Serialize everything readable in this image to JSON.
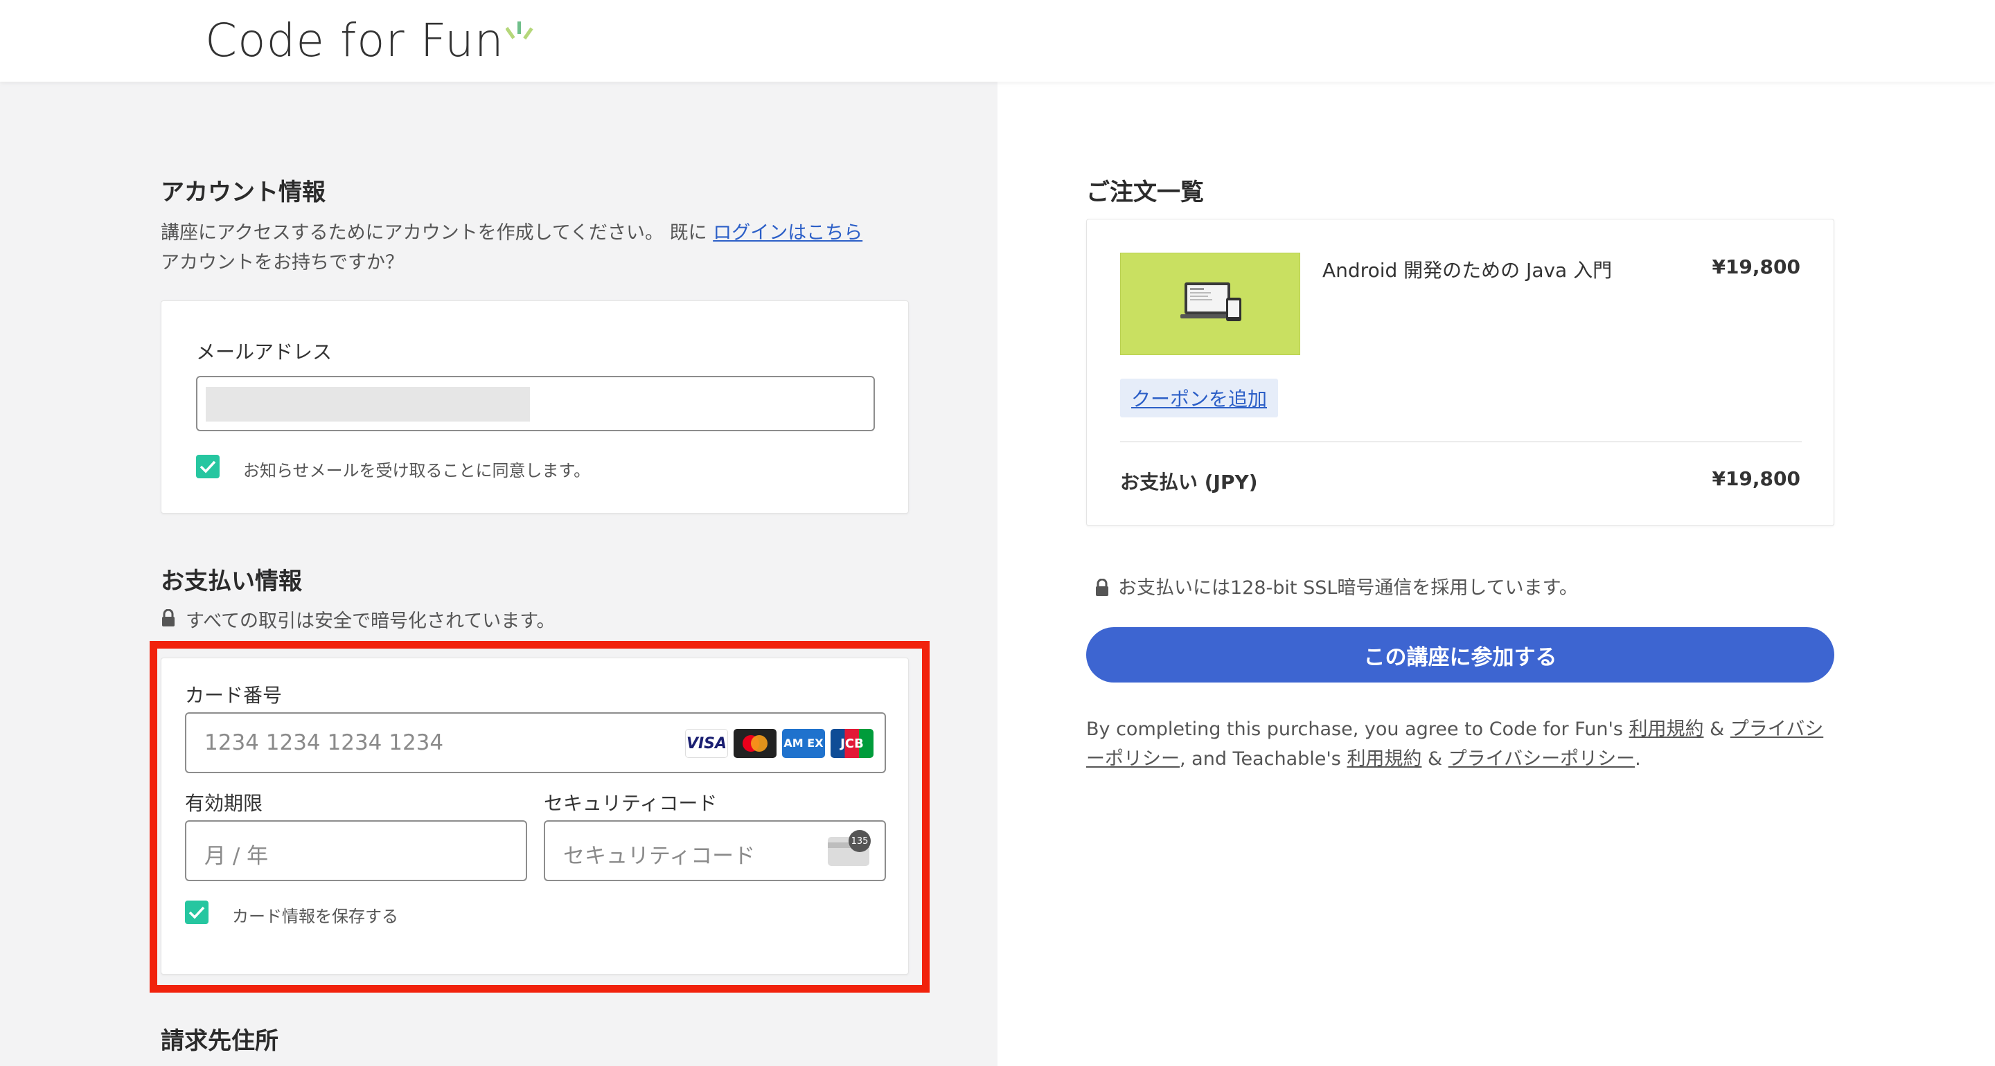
{
  "header": {
    "logo_text": "Code for Fun",
    "logo_accent_colors": [
      "#6fbf8a",
      "#b5d77a"
    ]
  },
  "account": {
    "title": "アカウント情報",
    "desc_line1": "講座にアクセスするためにアカウントを作成してください。 既に ",
    "login_link": "ログインはこちら",
    "desc_line2": "アカウントをお持ちですか？",
    "email_label": "メールアドレス",
    "email_value": "",
    "newsletter_label": "お知らせメールを受け取ることに同意します。",
    "newsletter_checked": true
  },
  "payment": {
    "title": "お支払い情報",
    "secure_note": "すべての取引は安全で暗号化されています。",
    "card_number_label": "カード番号",
    "card_number_placeholder": "1234 1234 1234 1234",
    "brands": [
      "VISA",
      "Mastercard",
      "AMEX",
      "JCB"
    ],
    "brand_visa_text": "VISA",
    "brand_amex_text": "AM EX",
    "brand_jcb_text": "JCB",
    "expiry_label": "有効期限",
    "expiry_placeholder": "月 / 年",
    "cvc_label": "セキュリティコード",
    "cvc_placeholder": "セキュリティコード",
    "cvc_icon_text": "135",
    "save_card_label": "カード情報を保存する",
    "save_card_checked": true,
    "highlight_color": "#f1220c"
  },
  "billing": {
    "title": "請求先住所"
  },
  "order": {
    "title": "ご注文一覧",
    "item_name": "Android 開発のための Java 入門",
    "item_price": "¥19,800",
    "coupon_label": "クーポンを追加",
    "total_label": "お支払い (JPY)",
    "total_price": "¥19,800",
    "ssl_note": "お支払いには128-bit SSL暗号通信を採用しています。",
    "cta_label": "この講座に参加する",
    "cta_color": "#3d65d1"
  },
  "legal": {
    "part1": "By completing this purchase, you agree to Code for Fun's ",
    "terms1": "利用規約",
    "amp1": " & ",
    "privacy1": "プライバシーポリシー",
    "part2": ", and Teachable's ",
    "terms2": "利用規約",
    "amp2": " & ",
    "privacy2": "プライバシーポリシー",
    "end": "."
  },
  "icons": {
    "lock": "lock-icon",
    "check": "check-icon",
    "cvc": "card-cvc-icon",
    "product": "laptop-phone-icon"
  }
}
